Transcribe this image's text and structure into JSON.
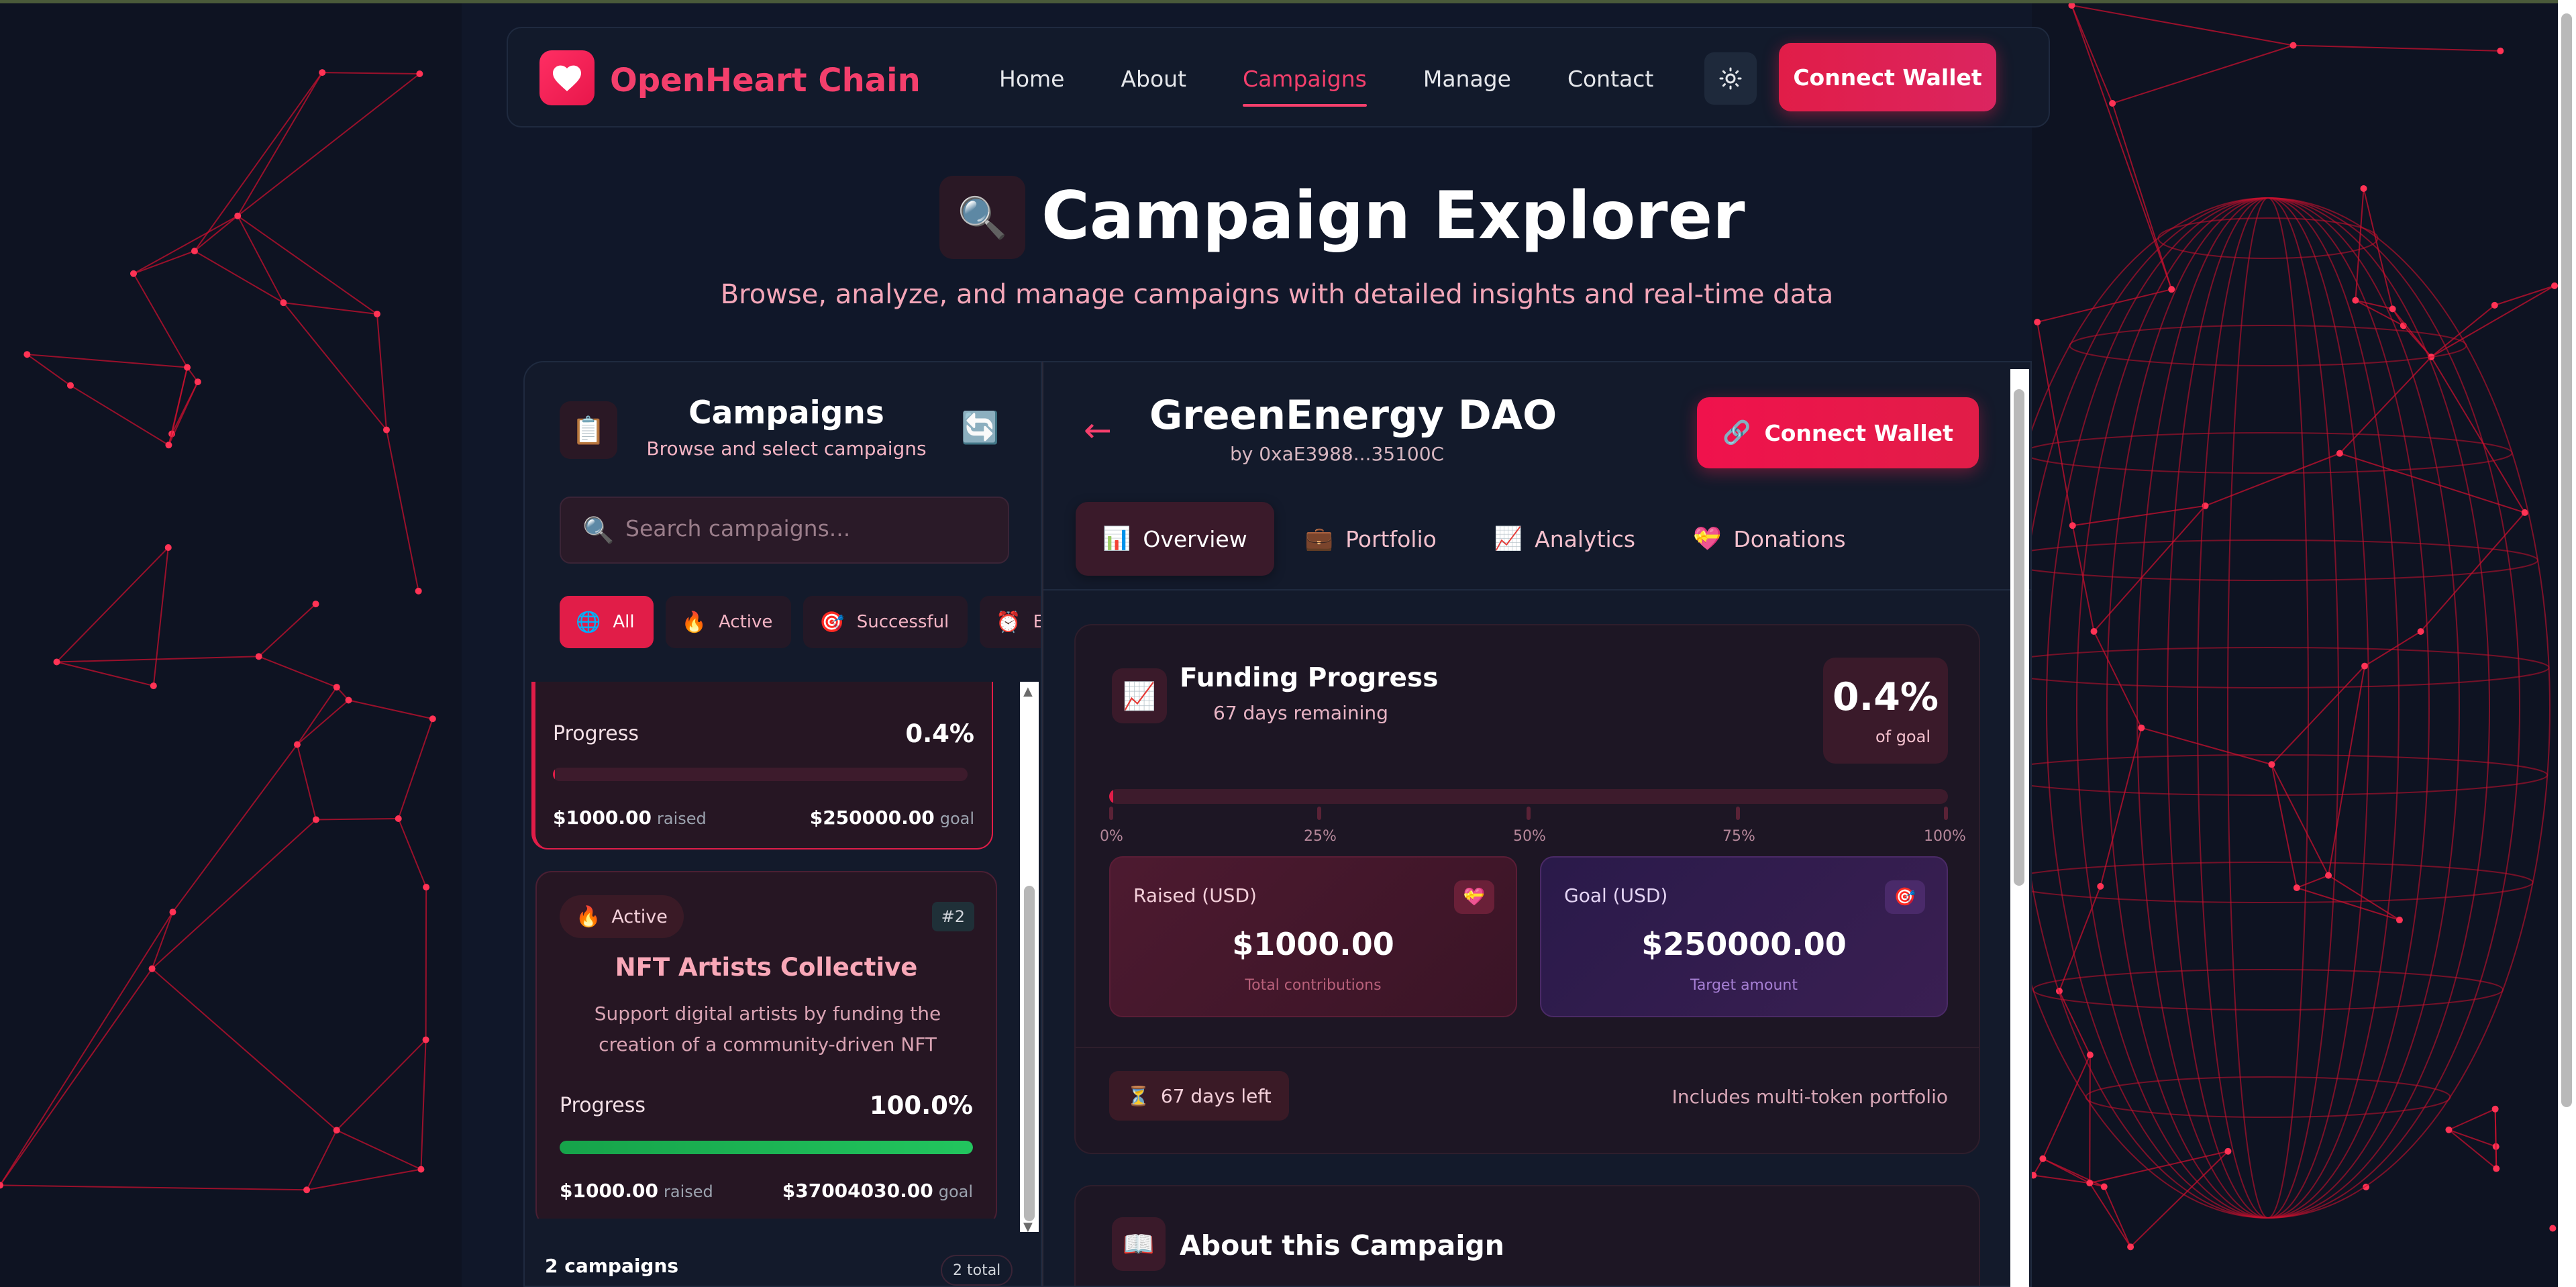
{
  "brand": {
    "name": "OpenHeart Chain",
    "logo_icon": "heart-icon"
  },
  "nav": {
    "links": [
      {
        "label": "Home",
        "active": false
      },
      {
        "label": "About",
        "active": false
      },
      {
        "label": "Campaigns",
        "active": true
      },
      {
        "label": "Manage",
        "active": false
      },
      {
        "label": "Contact",
        "active": false
      }
    ],
    "theme_icon": "sun-icon",
    "connect_label": "Connect Wallet"
  },
  "header": {
    "icon": "🔍",
    "title": "Campaign Explorer",
    "subtitle": "Browse, analyze, and manage campaigns with detailed insights and real-time data"
  },
  "left_panel": {
    "icon": "📋",
    "title": "Campaigns",
    "subtitle": "Browse and select campaigns",
    "refresh_icon": "🔄",
    "search": {
      "icon": "🔍",
      "placeholder": "Search campaigns...",
      "value": ""
    },
    "filters": [
      {
        "icon": "🌐",
        "label": "All",
        "active": true
      },
      {
        "icon": "🔥",
        "label": "Active",
        "active": false
      },
      {
        "icon": "🎯",
        "label": "Successful",
        "active": false
      },
      {
        "icon": "⏰",
        "label": "Ended",
        "active": false
      }
    ],
    "cards": [
      {
        "progress_label": "Progress",
        "progress_text": "0.4%",
        "progress": 0.004,
        "raised": "$1000.00",
        "raised_suffix": "raised",
        "goal": "$250000.00",
        "goal_suffix": "goal"
      },
      {
        "status_icon": "🔥",
        "status": "Active",
        "number": "#2",
        "title": "NFT Artists Collective",
        "description": "Support digital artists by funding the creation of a community-driven NFT marketplace on th...",
        "progress_label": "Progress",
        "progress_text": "100.0%",
        "progress": 1.0,
        "raised": "$1000.00",
        "raised_suffix": "raised",
        "goal": "$37004030.00",
        "goal_suffix": "goal"
      }
    ],
    "footer_count": "2 campaigns",
    "footer_total": "2 total"
  },
  "detail": {
    "back_icon": "←",
    "title": "GreenEnergy DAO",
    "by": "by 0xaE3988...35100C",
    "connect_icon": "🔗",
    "connect_label": "Connect Wallet",
    "tabs": [
      {
        "icon": "📊",
        "label": "Overview",
        "active": true
      },
      {
        "icon": "💼",
        "label": "Portfolio",
        "active": false
      },
      {
        "icon": "📈",
        "label": "Analytics",
        "active": false
      },
      {
        "icon": "💝",
        "label": "Donations",
        "active": false
      }
    ],
    "funding": {
      "icon": "📈",
      "title": "Funding Progress",
      "days_remaining": "67 days remaining",
      "percent": "0.4%",
      "of_goal": "of goal",
      "progress": 0.004,
      "ticks": [
        "0%",
        "25%",
        "50%",
        "75%",
        "100%"
      ],
      "raised": {
        "label": "Raised (USD)",
        "icon": "💝",
        "value": "$1000.00",
        "sub": "Total contributions"
      },
      "goal": {
        "label": "Goal (USD)",
        "icon": "🎯",
        "value": "$250000.00",
        "sub": "Target amount"
      },
      "days_left_icon": "⏳",
      "days_left": "67 days left",
      "note": "Includes multi-token portfolio"
    },
    "about": {
      "icon": "📖",
      "title": "About this Campaign"
    }
  },
  "colors": {
    "accent": "#e11d48",
    "brand": "#f43f6c",
    "background": "#0e1322",
    "lines": "#c8102e"
  }
}
